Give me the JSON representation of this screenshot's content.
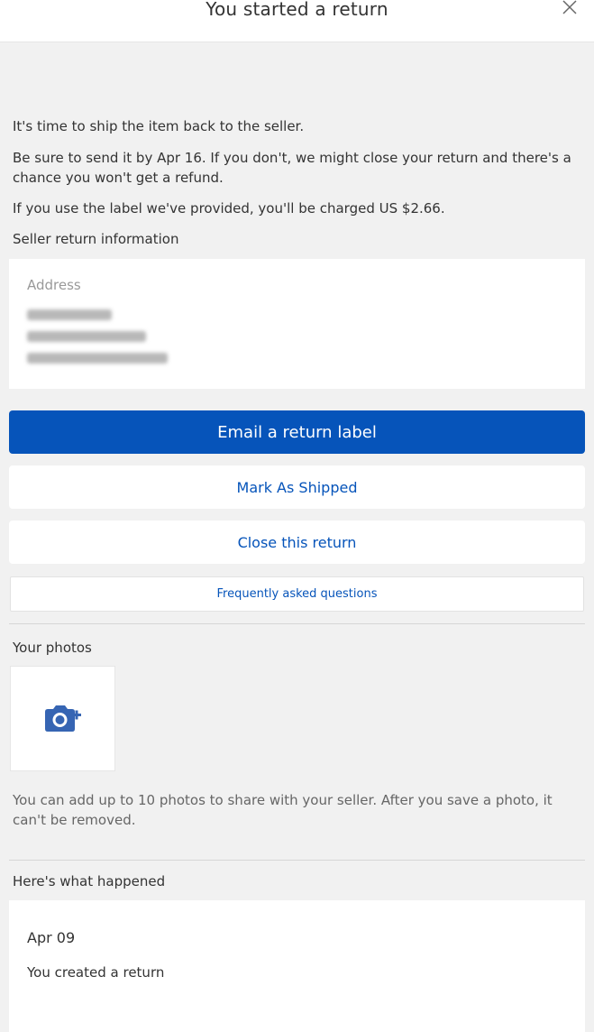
{
  "header": {
    "title": "You started a return",
    "close_icon": "close-icon"
  },
  "intro": {
    "ship_message": "It's time to ship the item back to the seller.",
    "deadline_message": "Be sure to send it by Apr 16. If you don't, we might close your return and there's a chance you won't get a refund.",
    "label_charge_message": "If you use the label we've provided, you'll be charged US $2.66."
  },
  "seller_info": {
    "heading": "Seller return information",
    "address_label": "Address"
  },
  "actions": {
    "email_label": "Email a return label",
    "mark_shipped": "Mark As Shipped",
    "close_return": "Close this return",
    "faq": "Frequently asked questions"
  },
  "photos": {
    "heading": "Your photos",
    "add_photo_icon": "add-photo-camera-icon",
    "note": "You can add up to 10 photos to share with your seller. After you save a photo, it can't be removed."
  },
  "history": {
    "heading": "Here's what happened",
    "events": [
      {
        "date": "Apr 09",
        "description": "You created a return"
      }
    ]
  },
  "colors": {
    "primary_blue": "#0654ba",
    "background": "#f1f1f1",
    "card": "#ffffff",
    "text": "#333333",
    "muted": "#999999"
  }
}
